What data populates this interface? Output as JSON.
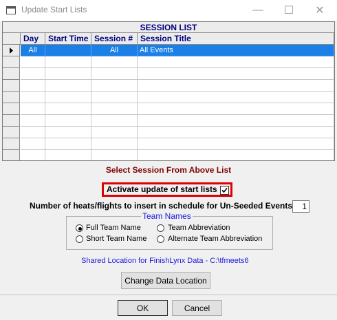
{
  "window": {
    "title": "Update Start Lists",
    "minimize_glyph": "—",
    "maximize_glyph": "☐",
    "close_glyph": "✕"
  },
  "grid": {
    "caption": "SESSION LIST",
    "columns": [
      "Day",
      "Start Time",
      "Session #",
      "Session Title"
    ],
    "rows": [
      {
        "day": "All",
        "start_time": "",
        "session": "All",
        "title": "All Events",
        "selected": true
      }
    ],
    "selected_row_color": "#1a80e6"
  },
  "panel": {
    "select_label": "Select Session From Above List",
    "activate_label": "Activate update of start lists",
    "activate_checked": true,
    "heats_label": "Number of heats/flights to insert in schedule for Un-Seeded Events :",
    "heats_value": "1",
    "team_names": {
      "legend": "Team Names",
      "options": [
        "Full Team Name",
        "Team Abbreviation",
        "Short Team Name",
        "Alternate Team Abbreviation"
      ],
      "selected": "Full Team Name"
    },
    "shared_location": "Shared Location for FinishLynx Data  -  C:\\tfmeets6",
    "change_button": "Change Data Location"
  },
  "footer": {
    "ok": "OK",
    "cancel": "Cancel"
  },
  "colors": {
    "highlight_box": "#e00000",
    "group_legend": "#1a1adb",
    "select_label": "#800000"
  }
}
